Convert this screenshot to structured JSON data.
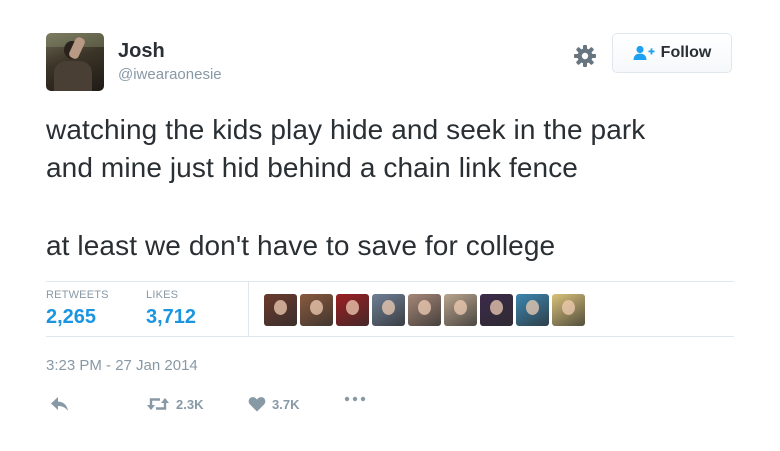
{
  "author": {
    "name": "Josh",
    "handle": "@iwearaonesie"
  },
  "follow_button": {
    "label": "Follow",
    "icon": "user-plus-icon"
  },
  "tweet": {
    "lines": [
      "watching the kids play hide and seek in the park",
      "and mine just hid behind a chain link fence",
      "at least we don't have to save for college"
    ]
  },
  "stats": {
    "retweets_label": "RETWEETS",
    "retweets_value": "2,265",
    "likes_label": "LIKES",
    "likes_value": "3,712"
  },
  "liker_avatars": [
    {
      "color": "#6b3a2c"
    },
    {
      "color": "#8a5a3e"
    },
    {
      "color": "#9b1f22"
    },
    {
      "color": "#6f7f95"
    },
    {
      "color": "#a58778"
    },
    {
      "color": "#b9a48e"
    },
    {
      "color": "#3c2a4a"
    },
    {
      "color": "#3c86b0"
    },
    {
      "color": "#d9c27a"
    }
  ],
  "timestamp": "3:23 PM - 27 Jan 2014",
  "actions": {
    "retweet_count": "2.3K",
    "like_count": "3.7K"
  },
  "colors": {
    "text": "#292f33",
    "muted": "#8899a6",
    "stat_value": "#1b95e0",
    "follow_icon": "#1da1f2",
    "divider": "#e1e8ed"
  }
}
